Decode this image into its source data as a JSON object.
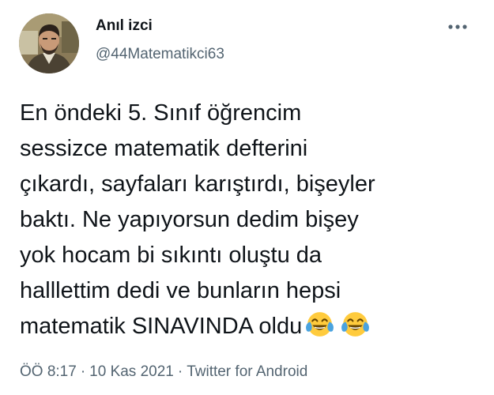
{
  "author": {
    "name": "Anıl izci",
    "handle": "@44Matematikci63"
  },
  "tweet": {
    "text": "En öndeki 5. Sınıf öğrencim\nsessizce matematik defterini\nçıkardı, sayfaları karıştırdı, bişeyler\nbaktı. Ne yapıyorsun dedim bişey\nyok hocam bi sıkıntı oluştu da\nhalllettim dedi ve bunların hepsi\nmatematik SINAVINDA oldu",
    "emojis": [
      "tears-of-joy-emoji",
      "tears-of-joy-emoji"
    ]
  },
  "meta": {
    "time": "ÖÖ 8:17",
    "separator": "·",
    "date": "10 Kas 2021",
    "source": "Twitter for Android"
  },
  "icons": {
    "more": "more-horizontal-icon"
  },
  "colors": {
    "text": "#0f1419",
    "secondary": "#536471",
    "background": "#ffffff",
    "emoji_face": "#ffcb3d",
    "emoji_tears": "#4aa3df"
  }
}
